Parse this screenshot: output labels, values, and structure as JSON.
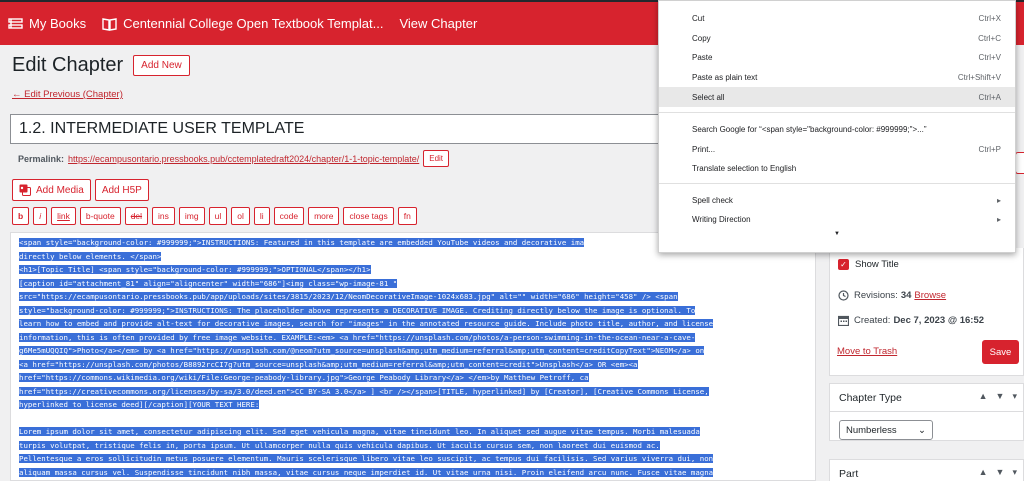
{
  "topbar": {
    "my_books": "My Books",
    "book_title": "Centennial College Open Textbook Templat...",
    "view_chapter": "View Chapter"
  },
  "main": {
    "page_title": "Edit Chapter",
    "add_new": "Add New",
    "edit_previous": "← Edit Previous (Chapter)",
    "chapter_title": "1.2. INTERMEDIATE USER TEMPLATE",
    "permalink_label": "Permalink:",
    "permalink_url": "https://ecampusontario.pressbooks.pub/cctemplatedraft2024/chapter/1-1-topic-template/",
    "permalink_edit": "Edit",
    "add_media": "Add Media",
    "add_h5p": "Add H5P"
  },
  "quicktags": [
    "b",
    "i",
    "link",
    "b-quote",
    "del",
    "ins",
    "img",
    "ul",
    "ol",
    "li",
    "code",
    "more",
    "close tags",
    "fn"
  ],
  "editor_lines": [
    "<span style=\"background-color: #999999;\">INSTRUCTIONS: Featured in this template are embedded YouTube videos and decorative ima",
    "directly below elements. </span>",
    "<h1>[Topic Title] <span style=\"background-color: #999999;\">OPTIONAL</span></h1>",
    "[caption id=\"attachment_81\" align=\"aligncenter\" width=\"686\"]<img class=\"wp-image-81 \"",
    "src=\"https://ecampusontario.pressbooks.pub/app/uploads/sites/3815/2023/12/NeomDecorativeImage-1024x683.jpg\" alt=\"\" width=\"686\" height=\"458\" /> <span",
    "style=\"background-color: #999999;\">INSTRUCTIONS: The placeholder above represents a DECORATIVE IMAGE. Crediting directly below the image is optional. To",
    "learn how to embed and provide alt-text for decorative images, search for \"images\" in the annotated resource guide. Include photo title, author, and license",
    "information, this is often provided by free image website. EXAMPLE:<em> <a href=\"https://unsplash.com/photos/a-person-swimming-in-the-ocean-near-a-cave-",
    "g6Me5mUQQIQ\">Photo</a></em> by <a href=\"https://unsplash.com/@neom?utm_source=unsplash&amp;utm_medium=referral&amp;utm_content=creditCopyText\">NEOM</a> on",
    "<a href=\"https://unsplash.com/photos/B8892rcCI7g?utm_source=unsplash&amp;utm_medium=referral&amp;utm_content=credit\">Unsplash</a> OR <em><a",
    "href=\"https://commons.wikimedia.org/wiki/File:George-peabody-library.jpg\">George Peabody Library</a> </em>by Matthew Petroff, ca",
    "href=\"https://creativecommons.org/licenses/by-sa/3.0/deed.en\">CC BY-SA 3.0</a> ] <br /></span>[TITLE, hyperlinked] by [Creator], [Creative Commons License,",
    "hyperlinked to license deed][/caption][YOUR TEXT HERE:",
    "",
    "Lorem ipsum dolor sit amet, consectetur adipiscing elit. Sed eget vehicula magna, vitae tincidunt leo. In aliquet sed augue vitae tempus. Morbi malesuada",
    "turpis volutpat, tristique felis in, porta ipsum. Ut ullamcorper nulla quis vehicula dapibus. Ut iaculis cursus sem, non laoreet dui euismod ac.",
    "Pellentesque a eros sollicitudin metus posuere elementum. Mauris scelerisque libero vitae leo suscipit, ac tempus dui facilisis. Sed varius viverra dui, non",
    "aliquam massa cursus vel. Suspendisse tincidunt nibh massa, vitae cursus neque imperdiet id. Ut vitae urna nisi. Proin eleifend arcu nunc. Fusce vitae magna"
  ],
  "side": {
    "show_title": "Show Title",
    "revisions_label": "Revisions:",
    "revisions_count": "34",
    "browse": "Browse",
    "created_label": "Created:",
    "created_date": "Dec 7, 2023 @ 16:52",
    "move_to_trash": "Move to Trash",
    "save": "Save",
    "chapter_type_title": "Chapter Type",
    "chapter_type_value": "Numberless",
    "part_title": "Part"
  },
  "context_menu": {
    "cut": "Cut",
    "cut_sc": "Ctrl+X",
    "copy": "Copy",
    "copy_sc": "Ctrl+C",
    "paste": "Paste",
    "paste_sc": "Ctrl+V",
    "paste_plain": "Paste as plain text",
    "paste_plain_sc": "Ctrl+Shift+V",
    "select_all": "Select all",
    "select_all_sc": "Ctrl+A",
    "search_google": "Search Google for “<span style=\"background-color: #999999;\">...”",
    "print": "Print...",
    "print_sc": "Ctrl+P",
    "translate": "Translate selection to English",
    "spell_check": "Spell check",
    "writing_direction": "Writing Direction"
  },
  "colors": {
    "brand": "#d7232e",
    "selection": "#3a6fd8"
  }
}
